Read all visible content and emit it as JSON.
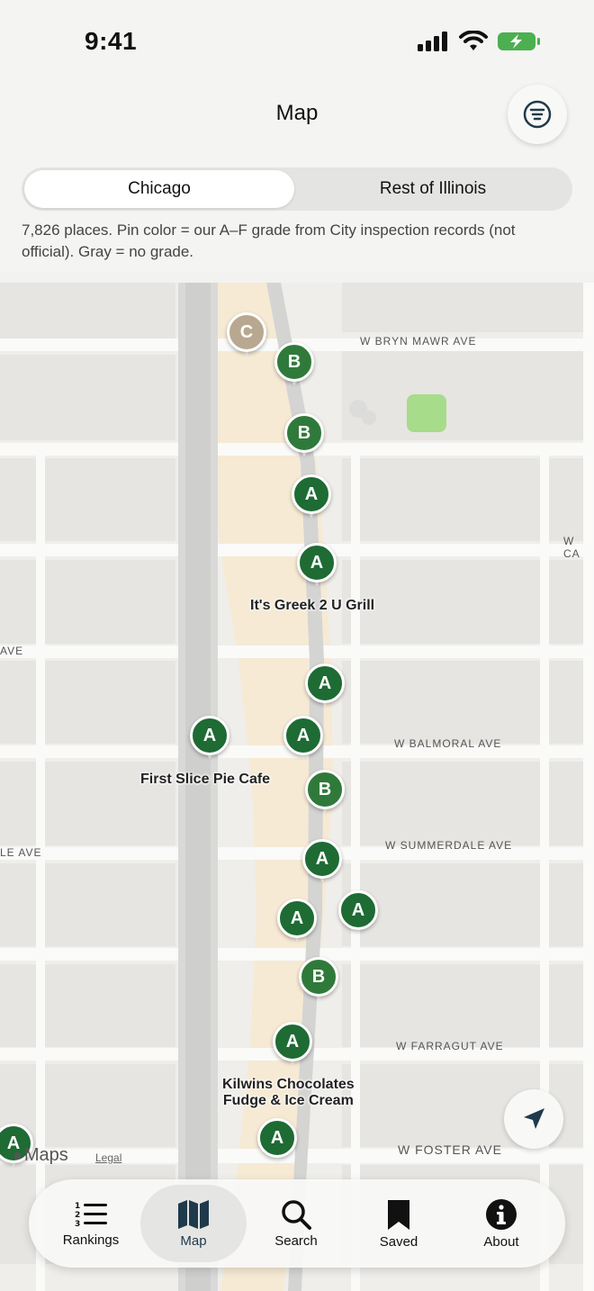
{
  "status_bar": {
    "time": "9:41"
  },
  "header": {
    "title": "Map",
    "segments": [
      "Chicago",
      "Rest of Illinois"
    ],
    "selected_segment": "Chicago",
    "info": "7,826 places. Pin color = our A–F grade from City inspection records (not official). Gray = no grade."
  },
  "map": {
    "streets": {
      "bryn_mawr": "W BRYN MAWR AVE",
      "ca": "W CA",
      "ave_left": "AVE",
      "balmoral": "W BALMORAL AVE",
      "summerdale": "W SUMMERDALE AVE",
      "le_ave": "LE AVE",
      "farragut": "W FARRAGUT AVE",
      "foster": "W FOSTER AVE"
    },
    "places": {
      "greek": "It's Greek 2 U Grill",
      "pie": "First Slice Pie Cafe",
      "kilwins": "Kilwins Chocolates\nFudge & Ice Cream"
    },
    "pins": [
      "C",
      "B",
      "B",
      "A",
      "A",
      "A",
      "A",
      "A",
      "B",
      "A",
      "A",
      "A",
      "B",
      "A",
      "A",
      "A"
    ],
    "colors": {
      "grade_a": "#1e6b34",
      "grade_b": "#2f7a3a",
      "gray": "#b8a890"
    },
    "attribution": "Maps",
    "legal": "Legal"
  },
  "tab_bar": {
    "tabs": [
      {
        "label": "Rankings",
        "icon": "list-numbered-icon"
      },
      {
        "label": "Map",
        "icon": "map-icon"
      },
      {
        "label": "Search",
        "icon": "search-icon"
      },
      {
        "label": "Saved",
        "icon": "bookmark-icon"
      },
      {
        "label": "About",
        "icon": "info-icon"
      }
    ],
    "active": "Map"
  }
}
